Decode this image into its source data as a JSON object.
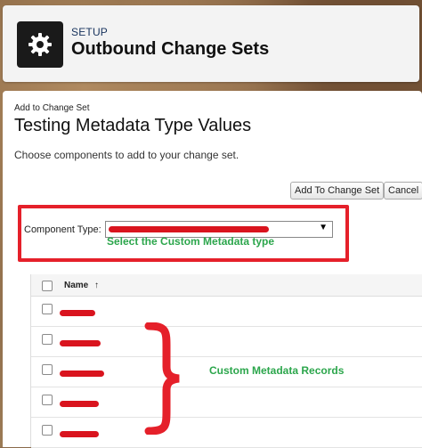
{
  "header": {
    "setup_label": "SETUP",
    "title": "Outbound Change Sets",
    "icon": "gear-icon"
  },
  "panel": {
    "breadcrumb": "Add to Change Set",
    "title": "Testing Metadata Type Values",
    "description": "Choose components to add to your change set.",
    "buttons": {
      "add": "Add To Change Set",
      "cancel": "Cancel"
    },
    "component_type": {
      "label": "Component Type:",
      "annotation": "Select the Custom Metadata type"
    },
    "list": {
      "name_header": "Name",
      "sort_indicator": "↑",
      "row_count": 5,
      "annotation": "Custom Metadata Records"
    }
  },
  "colors": {
    "annotation_red": "#e5202a",
    "annotation_green": "#2ca64c",
    "header_bg": "#f3f3f3"
  }
}
